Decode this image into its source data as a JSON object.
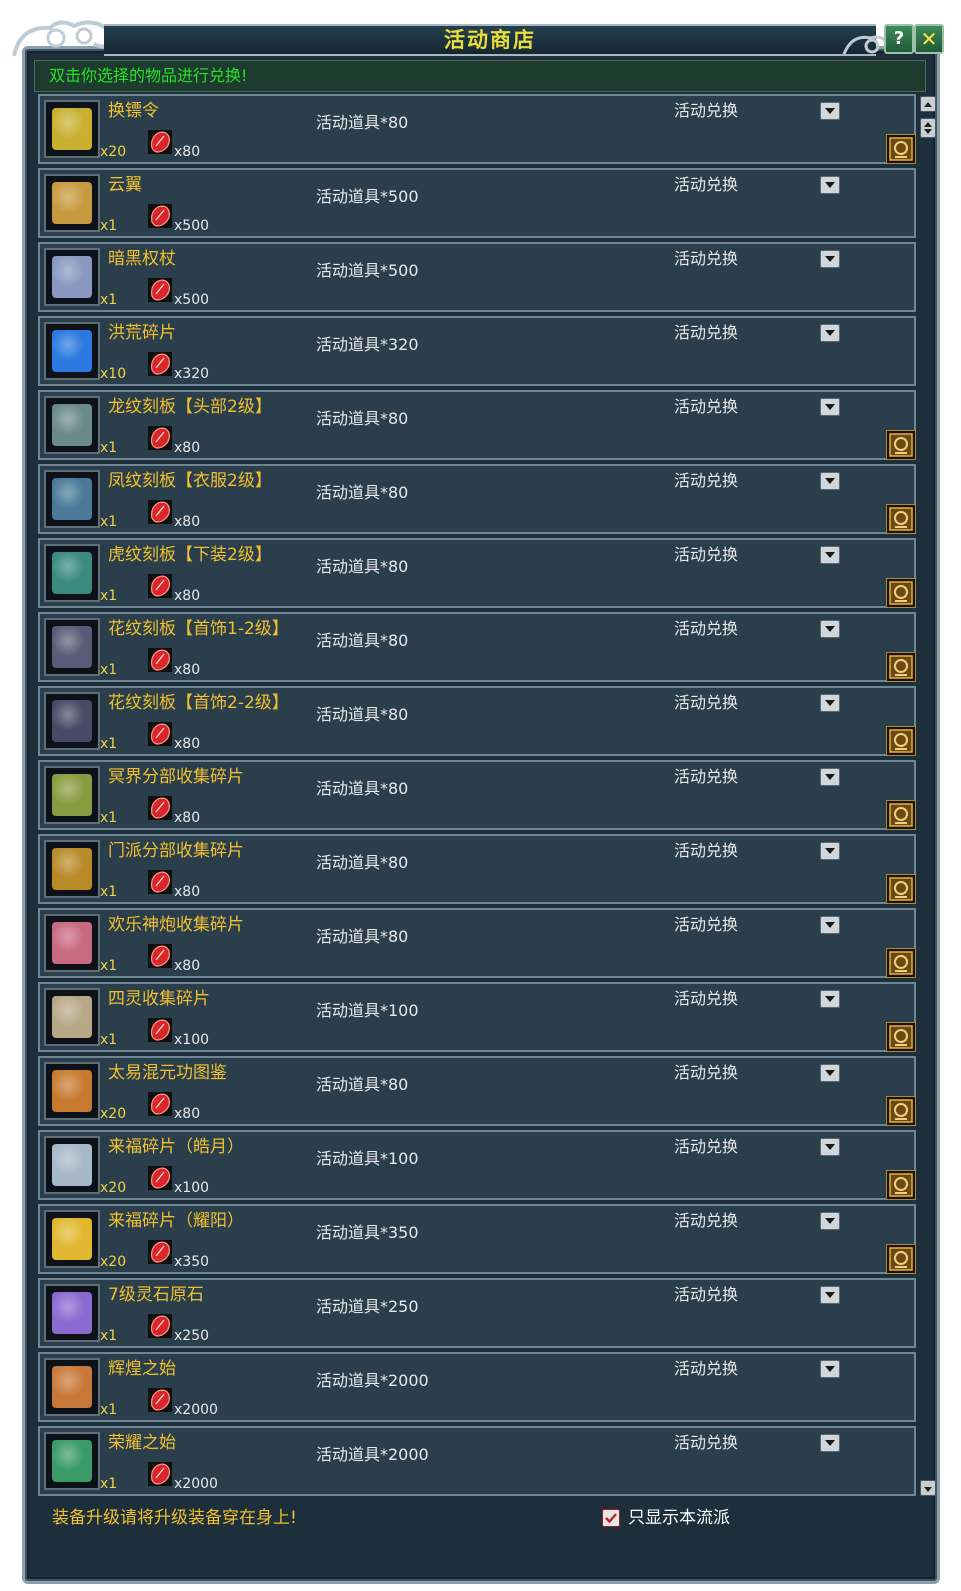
{
  "window": {
    "title": "活动商店",
    "help_label": "?",
    "close_label": "✕"
  },
  "hint": "双击你选择的物品进行兑换!",
  "items": [
    {
      "name": "换镖令",
      "qty": "x20",
      "cost": "x80",
      "req": "活动道具*80",
      "exchange": "活动兑换",
      "bound": true,
      "art": "#c8b030"
    },
    {
      "name": "云翼",
      "qty": "x1",
      "cost": "x500",
      "req": "活动道具*500",
      "exchange": "活动兑换",
      "bound": false,
      "art": "#c89a40"
    },
    {
      "name": "暗黑权杖",
      "qty": "x1",
      "cost": "x500",
      "req": "活动道具*500",
      "exchange": "活动兑换",
      "bound": false,
      "art": "#8898c0"
    },
    {
      "name": "洪荒碎片",
      "qty": "x10",
      "cost": "x320",
      "req": "活动道具*320",
      "exchange": "活动兑换",
      "bound": false,
      "art": "#2a78e0"
    },
    {
      "name": "龙纹刻板【头部2级】",
      "qty": "x1",
      "cost": "x80",
      "req": "活动道具*80",
      "exchange": "活动兑换",
      "bound": true,
      "art": "#6a8a8a"
    },
    {
      "name": "凤纹刻板【衣服2级】",
      "qty": "x1",
      "cost": "x80",
      "req": "活动道具*80",
      "exchange": "活动兑换",
      "bound": true,
      "art": "#4a7a98"
    },
    {
      "name": "虎纹刻板【下装2级】",
      "qty": "x1",
      "cost": "x80",
      "req": "活动道具*80",
      "exchange": "活动兑换",
      "bound": true,
      "art": "#3a8a80"
    },
    {
      "name": "花纹刻板【首饰1-2级】",
      "qty": "x1",
      "cost": "x80",
      "req": "活动道具*80",
      "exchange": "活动兑换",
      "bound": true,
      "art": "#5a5a78"
    },
    {
      "name": "花纹刻板【首饰2-2级】",
      "qty": "x1",
      "cost": "x80",
      "req": "活动道具*80",
      "exchange": "活动兑换",
      "bound": true,
      "art": "#4a4a68"
    },
    {
      "name": "冥界分部收集碎片",
      "qty": "x1",
      "cost": "x80",
      "req": "活动道具*80",
      "exchange": "活动兑换",
      "bound": true,
      "art": "#8a9a40"
    },
    {
      "name": "门派分部收集碎片",
      "qty": "x1",
      "cost": "x80",
      "req": "活动道具*80",
      "exchange": "活动兑换",
      "bound": true,
      "art": "#b88a28"
    },
    {
      "name": "欢乐神炮收集碎片",
      "qty": "x1",
      "cost": "x80",
      "req": "活动道具*80",
      "exchange": "活动兑换",
      "bound": true,
      "art": "#c86a80"
    },
    {
      "name": "四灵收集碎片",
      "qty": "x1",
      "cost": "x100",
      "req": "活动道具*100",
      "exchange": "活动兑换",
      "bound": true,
      "art": "#b8a888"
    },
    {
      "name": "太易混元功图鉴",
      "qty": "x20",
      "cost": "x80",
      "req": "活动道具*80",
      "exchange": "活动兑换",
      "bound": true,
      "art": "#c87a30"
    },
    {
      "name": "来福碎片（皓月）",
      "qty": "x20",
      "cost": "x100",
      "req": "活动道具*100",
      "exchange": "活动兑换",
      "bound": true,
      "art": "#a8b8c8"
    },
    {
      "name": "来福碎片（耀阳）",
      "qty": "x20",
      "cost": "x350",
      "req": "活动道具*350",
      "exchange": "活动兑换",
      "bound": true,
      "art": "#e0b830"
    },
    {
      "name": "7级灵石原石",
      "qty": "x1",
      "cost": "x250",
      "req": "活动道具*250",
      "exchange": "活动兑换",
      "bound": false,
      "art": "#8a6ad0"
    },
    {
      "name": "辉煌之始",
      "qty": "x1",
      "cost": "x2000",
      "req": "活动道具*2000",
      "exchange": "活动兑换",
      "bound": false,
      "art": "#c87838"
    },
    {
      "name": "荣耀之始",
      "qty": "x1",
      "cost": "x2000",
      "req": "活动道具*2000",
      "exchange": "活动兑换",
      "bound": false,
      "art": "#3a9a68"
    }
  ],
  "footer": {
    "notice": "装备升级请将升级装备穿在身上!",
    "filter_label": "只显示本流派",
    "filter_checked": true
  },
  "colors": {
    "panel": "#1e2f3c",
    "row": "#2b3e4b",
    "name": "#f0c030",
    "hint": "#28e028",
    "title": "#e8de3a",
    "gem": "#d8262a"
  },
  "icons": {
    "dropdown": "chevron-down-icon",
    "gem": "red-gem-icon",
    "bind": "bound-seal-icon",
    "help": "help-icon",
    "close": "close-icon"
  }
}
